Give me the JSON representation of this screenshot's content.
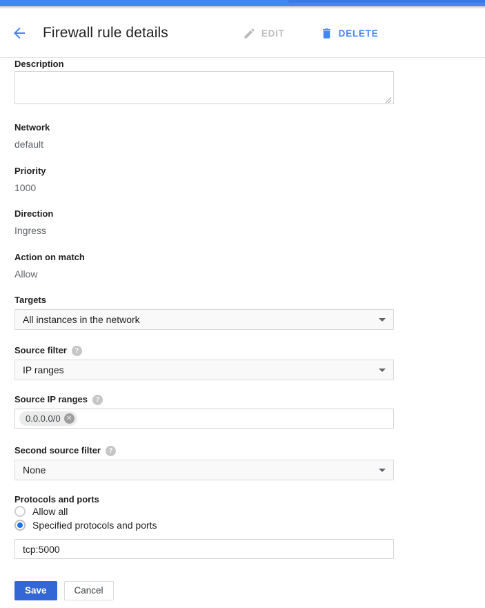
{
  "window": {
    "accent_blue": "#4285f4",
    "link_blue": "#1a73e8"
  },
  "header": {
    "back_icon": "arrow-left-icon",
    "title": "Firewall rule details",
    "actions": [
      {
        "label": "EDIT",
        "icon": "pencil-icon",
        "enabled": false,
        "color": "#bdbdbd"
      },
      {
        "label": "DELETE",
        "icon": "trash-icon",
        "enabled": true,
        "color": "#4285f4"
      }
    ]
  },
  "form": {
    "description": {
      "label": "Description",
      "value": "",
      "placeholder": ""
    },
    "network": {
      "label": "Network",
      "value": "default"
    },
    "priority": {
      "label": "Priority",
      "value": "1000"
    },
    "direction": {
      "label": "Direction",
      "value": "Ingress"
    },
    "action_on_match": {
      "label": "Action on match",
      "value": "Allow"
    },
    "targets": {
      "label": "Targets",
      "value": "All instances in the network",
      "caret_icon": "chevron-down-icon"
    },
    "source_filter": {
      "label": "Source filter",
      "help_icon": "help-icon",
      "value": "IP ranges",
      "caret_icon": "chevron-down-icon"
    },
    "source_ip_ranges": {
      "label": "Source IP ranges",
      "help_icon": "help-icon",
      "chips": [
        {
          "text": "0.0.0.0/0",
          "remove_icon": "close-circle-icon",
          "remove_glyph": "✕"
        }
      ]
    },
    "second_source_filter": {
      "label": "Second source filter",
      "help_icon": "help-icon",
      "value": "None",
      "caret_icon": "chevron-down-icon"
    },
    "protocols_and_ports": {
      "label": "Protocols and ports",
      "options": [
        {
          "label": "Allow all",
          "selected": false
        },
        {
          "label": "Specified protocols and ports",
          "selected": true
        }
      ],
      "value": "tcp:5000"
    }
  },
  "footer": {
    "save_label": "Save",
    "cancel_label": "Cancel"
  }
}
